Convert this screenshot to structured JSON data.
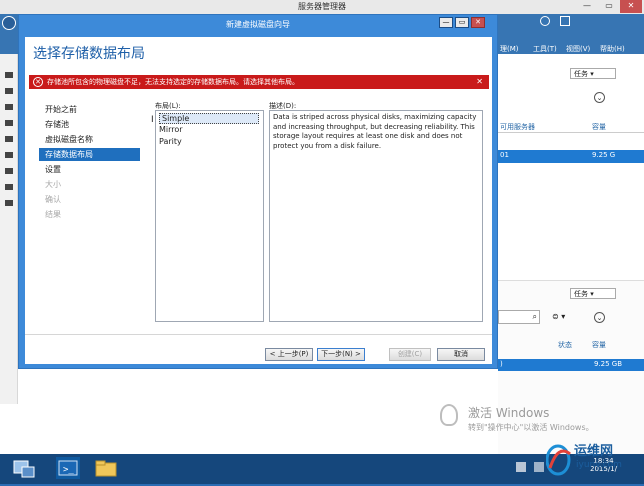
{
  "server_manager": {
    "title": "服务器管理器",
    "menu": [
      "理(M)",
      "工具(T)",
      "视图(V)",
      "帮助(H)"
    ],
    "tasks_label": "任务",
    "col_server": "可用服务器",
    "col_capacity": "容量",
    "row_server": "01",
    "row_capacity": "9.25 G",
    "col_status": "状态",
    "col_capacity2": "容量",
    "row2_server": ")",
    "row2_capacity": "9.25 GB"
  },
  "wizard": {
    "title": "新建虚拟磁盘向导",
    "heading": "选择存储数据布局",
    "error_text": "存储池所包含的物理磁盘不足，无法支持选定的存储数据布局。请选择其他布局。",
    "steps": [
      {
        "label": "开始之前",
        "enabled": true
      },
      {
        "label": "存储池",
        "enabled": true
      },
      {
        "label": "虚拟磁盘名称",
        "enabled": true
      },
      {
        "label": "存储数据布局",
        "enabled": true,
        "active": true
      },
      {
        "label": "设置",
        "enabled": true
      },
      {
        "label": "大小",
        "enabled": false
      },
      {
        "label": "确认",
        "enabled": false
      },
      {
        "label": "结果",
        "enabled": false
      }
    ],
    "layout_label": "布局(L):",
    "layouts": [
      "Simple",
      "Mirror",
      "Parity"
    ],
    "selected_layout": "Simple",
    "description_label": "描述(D):",
    "description": "Data is striped across physical disks, maximizing capacity and increasing throughput, but decreasing reliability. This storage layout requires at least one disk and does not protect you from a disk failure.",
    "buttons": {
      "prev": "< 上一步(P)",
      "next": "下一步(N) >",
      "create": "创建(C)",
      "cancel": "取消"
    }
  },
  "activation": {
    "title": "激活 Windows",
    "subtitle": "转到\"操作中心\"以激活 Windows。"
  },
  "taskbar": {
    "time": "18:34",
    "date": "2015/1/"
  },
  "watermark": {
    "brand": "运维网",
    "domain": "iyunv.com"
  },
  "colors": {
    "accent": "#3775b3",
    "wizard_frame": "#3d8ad9",
    "error": "#c91a1a",
    "selection": "#1f7ad1"
  }
}
